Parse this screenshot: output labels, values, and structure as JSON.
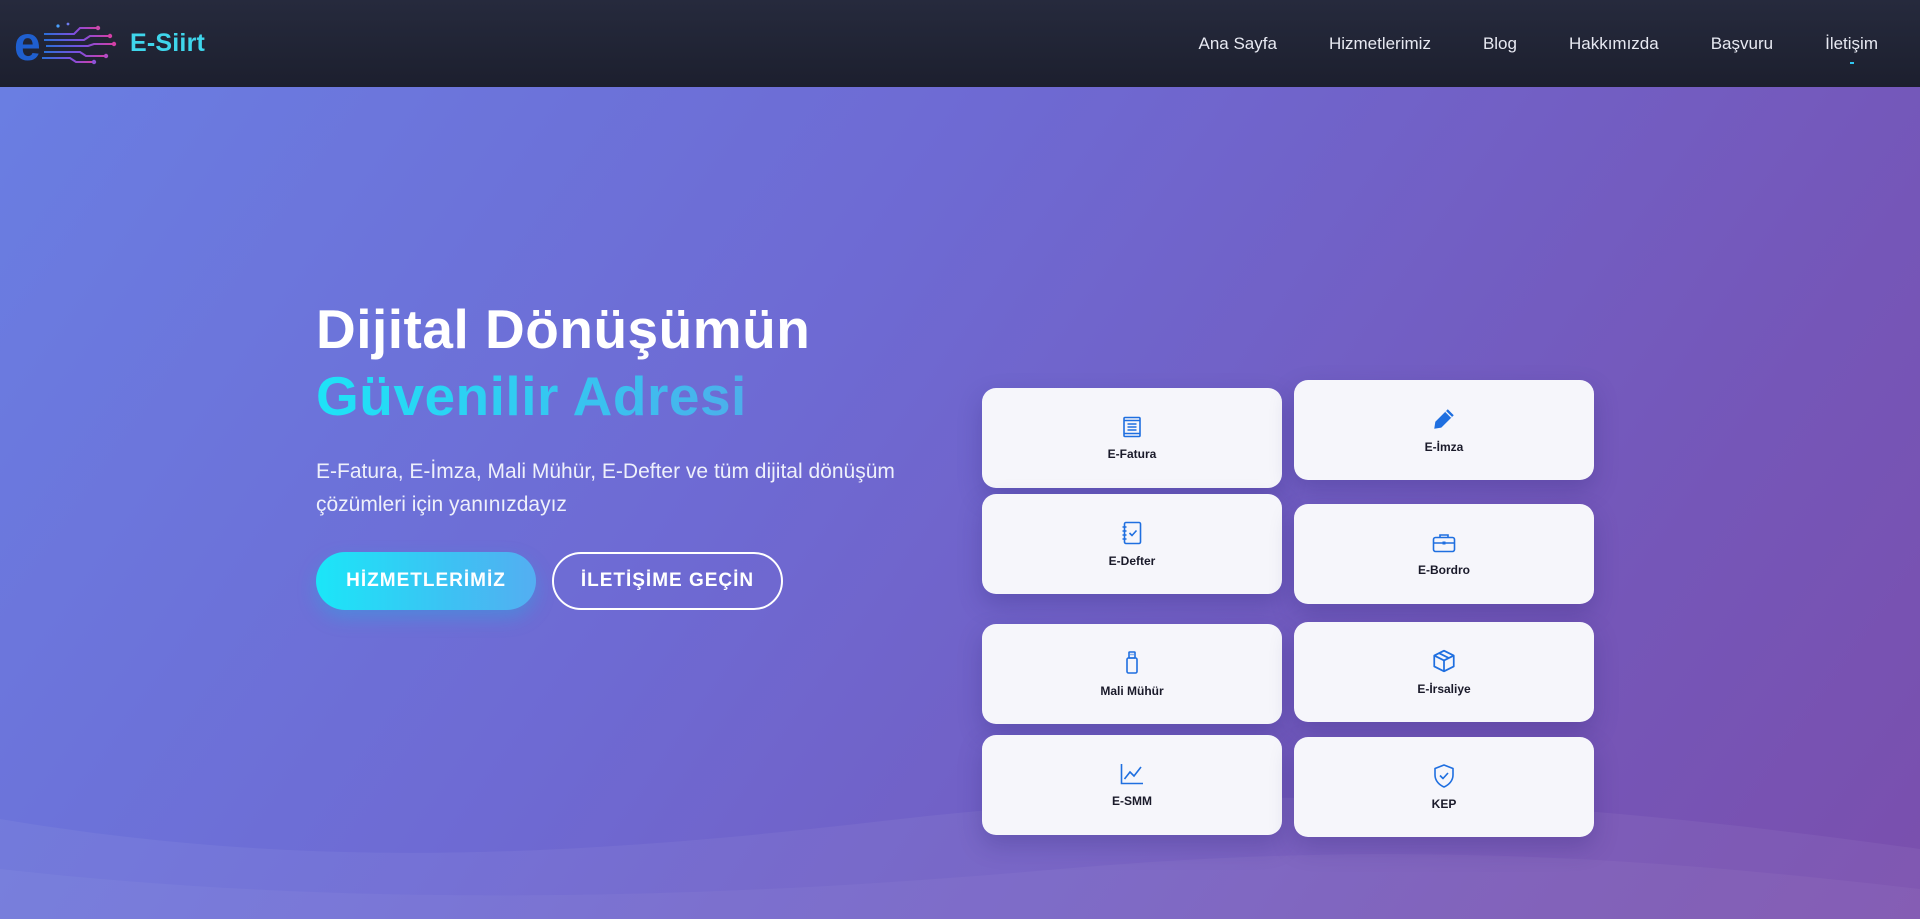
{
  "brand": {
    "name": "E-Siirt"
  },
  "nav": {
    "items": [
      {
        "label": "Ana Sayfa"
      },
      {
        "label": "Hizmetlerimiz"
      },
      {
        "label": "Blog"
      },
      {
        "label": "Hakkımızda"
      },
      {
        "label": "Başvuru"
      },
      {
        "label": "İletişim",
        "active": true
      }
    ]
  },
  "hero": {
    "title_line1": "Dijital Dönüşümün",
    "title_line2": "Güvenilir Adresi",
    "subtitle": "E-Fatura, E-İmza, Mali Mühür, E-Defter ve tüm dijital dönüşüm çözümleri için yanınızdayız",
    "primary_button": "HİZMETLERİMİZ",
    "secondary_button": "İLETİŞİME GEÇİN"
  },
  "services": [
    {
      "label": "E-Fatura",
      "icon": "receipt-icon"
    },
    {
      "label": "E-İmza",
      "icon": "pen-icon"
    },
    {
      "label": "E-Defter",
      "icon": "checklist-icon"
    },
    {
      "label": "E-Bordro",
      "icon": "briefcase-icon"
    },
    {
      "label": "Mali Mühür",
      "icon": "usb-stick-icon"
    },
    {
      "label": "E-İrsaliye",
      "icon": "box-icon"
    },
    {
      "label": "E-SMM",
      "icon": "chart-line-icon"
    },
    {
      "label": "KEP",
      "icon": "shield-check-icon"
    }
  ],
  "colors": {
    "navbar": "#1f2233",
    "accent": "#30c6f0",
    "icon": "#1f6fe0",
    "card": "#f6f6fb"
  }
}
